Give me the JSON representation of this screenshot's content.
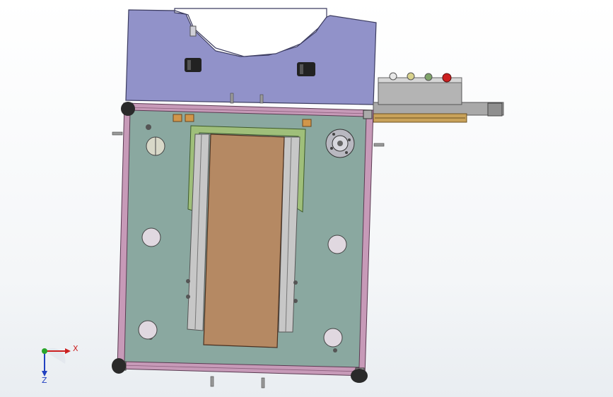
{
  "colors": {
    "background": "#ffffff",
    "upper_housing": "#9192c9",
    "base_plate": "#8aa8a0",
    "frame": "#c79ab8",
    "belt_tray": "#b58963",
    "guide_rail": "#9fbf7a",
    "stop_button": "#cc2020",
    "axis_x": "#cc2020",
    "axis_y": "#2aa52a",
    "axis_z": "#2040c0"
  },
  "triad": {
    "x_label": "X",
    "z_label": "Z"
  },
  "icons": {
    "triad": "coordinate-triad-icon",
    "buttons": [
      "indicator-button-icon",
      "indicator-button-icon",
      "indicator-button-icon",
      "emergency-stop-icon"
    ]
  }
}
